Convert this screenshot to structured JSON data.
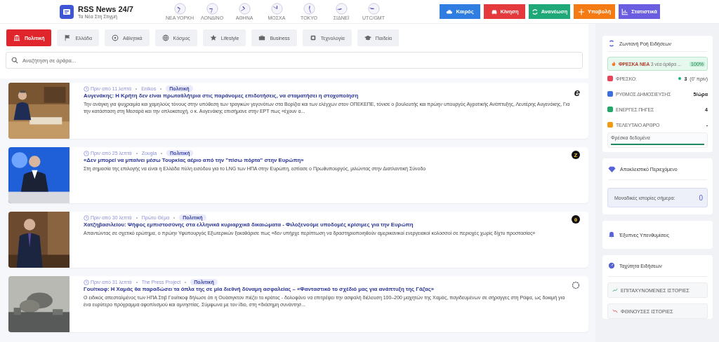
{
  "brand": {
    "title": "RSS News 24/7",
    "subtitle": "Τα Νέα Στη Στιγμή"
  },
  "clocks": [
    {
      "label": "ΝΕΑ ΥΟΡΚΗ"
    },
    {
      "label": "ΛΟΝΔΙΝΟ"
    },
    {
      "label": "ΑΘΗΝΑ"
    },
    {
      "label": "ΜΟΣΧΑ"
    },
    {
      "label": "ΤΟΚΥΟ"
    },
    {
      "label": "ΣΙΔΝΕΪ"
    },
    {
      "label": "UTC/GMT"
    }
  ],
  "actions": [
    {
      "label": "Καιρός",
      "color": "#2f7de1"
    },
    {
      "label": "Κίνηση",
      "color": "#e53a3d"
    },
    {
      "label": "Ανανέωση",
      "color": "#1fa878"
    },
    {
      "label": "Υποβολή",
      "color": "#f47b14"
    },
    {
      "label": "Στατιστικά",
      "color": "#6b5de0"
    }
  ],
  "tabs": [
    {
      "label": "Πολιτική",
      "selected": true
    },
    {
      "label": "Ελλάδα",
      "selected": false
    },
    {
      "label": "Αθλητικά",
      "selected": false
    },
    {
      "label": "Κόσμος",
      "selected": false
    },
    {
      "label": "Lifestyle",
      "selected": false
    },
    {
      "label": "Business",
      "selected": false
    },
    {
      "label": "Τεχνολογία",
      "selected": false
    },
    {
      "label": "Παιδεία",
      "selected": false
    }
  ],
  "search": {
    "placeholder": "Αναζήτηση σε άρθρα..."
  },
  "articles": [
    {
      "time": "Πριν από 11 λεπτά",
      "source": "Enikos",
      "category": "Πολιτική",
      "title": "Αυγενάκης: Η Κρήτη δεν είναι πρωταθλήτρια στις παράνομες επιδοτήσεις, να σταματήσει η στοχοποίηση",
      "summary": "Την ανάγκη για ψυχραιμία και χαμηλούς τόνους στην υπόθεση των τραγικών γεγονότων στα Βορίζια και των ελέγχων στον ΟΠΕΚΕΠΕ, τόνισε ο βουλευτής και πρώην υπουργός Αγροτικής Ανάπτυξης, Λευτέρης Αυγενάκης, Για την κατάσταση στη Μεσαρά και την οπλοκατοχή, ο κ. Αυγενάκης επισήμανε στην ΕΡΤ πως «έχουν α...",
      "logo": {
        "kind": "letter",
        "text": "e"
      }
    },
    {
      "time": "Πριν από 25 λεπτά",
      "source": "Zougla",
      "category": "Πολιτική",
      "title": "«Δεν μπορεί να μπαίνει μέσω Τουρκίας αέριο από την \"πίσω πόρτα\" στην Ευρώπη»",
      "summary": "Στη σημασία της επιλογής να είναι η Ελλάδα πύλη εισόδου για το LNG των ΗΠΑ στην Ευρώπη, εστίασε ο Πρωθυπουργός, μιλώντας στην Διατλαντική Σύνοδο",
      "logo": {
        "kind": "badge",
        "text": "Z"
      }
    },
    {
      "time": "Πριν από 30 λεπτά",
      "source": "Πρώτο Θέμα",
      "category": "Πολιτική",
      "title": "Χατζηβασιλείου: Ψήφος εμπιστοσύνης στα ελληνικά κυριαρχικά δικαιώματα - Φιλοξενούμε υποδομές κρίσιμες για την Ευρώπη",
      "summary": "Απαντώντας σε σχετικό ερώτημα, ο πρώην Υφυπουργός Εξωτερικών ξεκαθάρισε πως «δεν υπήρχε περίπτωση να δραστηριοποιηθούν αμερικανικοί ενεργειακοί κολοσσοί σε περιοχές χωρίς δίχτυ προστασίας»",
      "logo": {
        "kind": "badge",
        "text": "θ"
      }
    },
    {
      "time": "Πριν από 31 λεπτά",
      "source": "The Press Project",
      "category": "Πολιτική",
      "title": "Γουίτκοφ: Η Χαμάς θα παραδώσει τα όπλα της σε μία διεθνή δύναμη ασφαλείας – «Φανταστικό το σχέδιό μας για ανάπτυξη της Γάζας»",
      "summary": "Ο ειδικός απεσταλμένος των ΗΠΑ Στιβ Γουίτκοφ δήλωσε ότι η Ουάσιγκτον πιέζει το κράτος - δολοφόνο να επιτρέψει την ασφαλή διέλευση 100–200 μαχητών της Χαμάς, παγιδευμένων σε σήραγγες στη Ράφα, ως δοκιμή για ένα ευρύτερο πρόγραμμα αφοπλισμού και αμνηστίας. Σύμφωνα με τον ίδιο, στη «διάσημη συνάντησ...",
      "logo": {
        "kind": "ring"
      }
    }
  ],
  "live_feed": {
    "title": "Ζωντανή Ροή Ειδήσεων",
    "banner": {
      "label": "ΦΡΕΣΚΑ ΝΕΑ",
      "text": "3 νέα άρθρα ...",
      "badge": "100%"
    },
    "stats": [
      {
        "label": "ΦΡΕΣΚΟ:",
        "value": "3",
        "note": "(0' πριν)",
        "color": "#e9445a"
      },
      {
        "label": "ΡΥΘΜΟΣ ΔΗΜΟΣΙΕΥΣΗΣ",
        "value": "5/ώρα",
        "color": "#3b6fe0"
      },
      {
        "label": "ΕΝΕΡΓΕΣ ΠΗΓΕΣ",
        "value": "4",
        "color": "#22a86a"
      },
      {
        "label": "ΤΕΛΕΥΤΑΙΟ ΑΡΘΡΟ",
        "value": "-",
        "color": "#f29a14"
      }
    ],
    "freshness": {
      "label": "Φρέσκα δεδομένα",
      "level": 1
    }
  },
  "exclusive": {
    "title": "Αποκλειστικό Περιεχόμενο",
    "label": "Μοναδικές ιστορίες σήμερα:",
    "value": "0"
  },
  "reminders": {
    "title": "Έξυπνες Υπενθυμίσεις"
  },
  "speed": {
    "title": "Ταχύτητα Ειδήσεων",
    "rows": [
      {
        "label": "ΕΠΙΤΑΧΥΝΟΜΕΝΕΣ ΙΣΤΟΡΙΕΣ"
      },
      {
        "label": "ΦΘΙΝΟΥΣΕΣ ΙΣΤΟΡΙΕΣ"
      }
    ]
  }
}
